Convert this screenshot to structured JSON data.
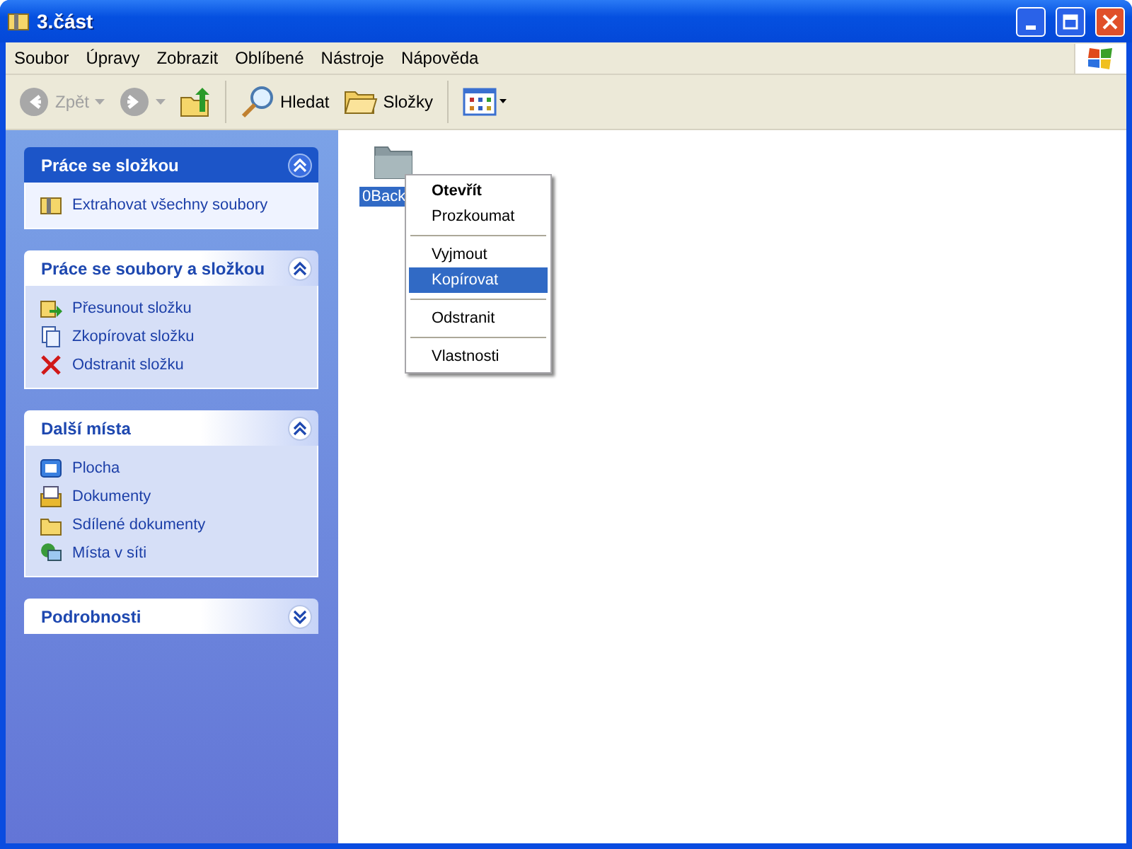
{
  "window": {
    "title": "3.část"
  },
  "menu": [
    "Soubor",
    "Úpravy",
    "Zobrazit",
    "Oblíbené",
    "Nástroje",
    "Nápověda"
  ],
  "toolbar": [
    {
      "kind": "back",
      "label": "Zpět",
      "disabled": true
    },
    {
      "kind": "forward",
      "disabled": true
    },
    {
      "kind": "up"
    },
    {
      "kind": "search",
      "label": "Hledat"
    },
    {
      "kind": "folders",
      "label": "Složky"
    },
    {
      "kind": "views"
    }
  ],
  "panels": [
    {
      "title": "Práce se složkou",
      "primary": true,
      "expanded": true,
      "items": [
        {
          "kind": "zip",
          "label": "Extrahovat všechny soubory"
        }
      ]
    },
    {
      "title": "Práce se soubory a složkou",
      "primary": false,
      "expanded": true,
      "items": [
        {
          "kind": "move",
          "label": "Přesunout složku"
        },
        {
          "kind": "copy",
          "label": "Zkopírovat složku"
        },
        {
          "kind": "delete",
          "label": "Odstranit složku"
        }
      ]
    },
    {
      "title": "Další místa",
      "primary": false,
      "expanded": true,
      "items": [
        {
          "kind": "desktop",
          "label": "Plocha"
        },
        {
          "kind": "documents",
          "label": "Dokumenty"
        },
        {
          "kind": "folder",
          "label": "Sdílené dokumenty"
        },
        {
          "kind": "network",
          "label": "Místa v síti"
        }
      ]
    },
    {
      "title": "Podrobnosti",
      "primary": false,
      "expanded": false
    }
  ],
  "files": [
    {
      "label": "0Back",
      "selected": true
    }
  ],
  "context_menu": [
    {
      "kind": "item",
      "label": "Otevřít",
      "default": true,
      "selected": false
    },
    {
      "kind": "item",
      "label": "Prozkoumat",
      "default": false,
      "selected": false
    },
    {
      "kind": "separator"
    },
    {
      "kind": "item",
      "label": "Vyjmout",
      "default": false,
      "selected": false
    },
    {
      "kind": "item",
      "label": "Kopírovat",
      "default": false,
      "selected": true
    },
    {
      "kind": "separator"
    },
    {
      "kind": "item",
      "label": "Odstranit",
      "default": false,
      "selected": false
    },
    {
      "kind": "separator"
    },
    {
      "kind": "item",
      "label": "Vlastnosti",
      "default": false,
      "selected": false
    }
  ]
}
